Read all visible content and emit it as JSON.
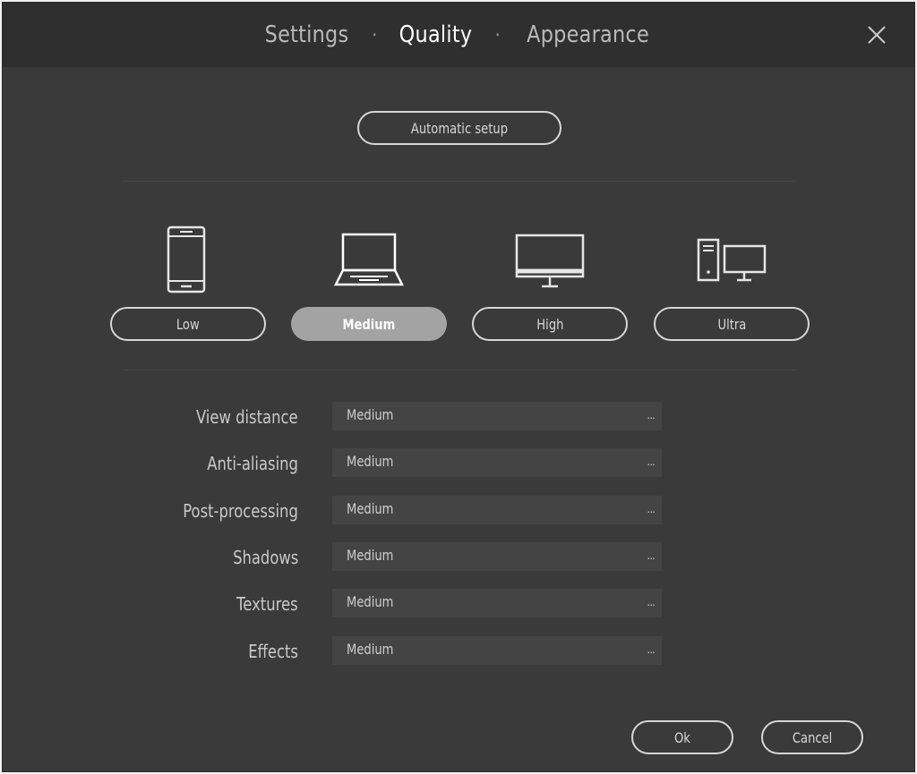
{
  "tabs": [
    {
      "label": "Settings",
      "active": false
    },
    {
      "label": "Quality",
      "active": true
    },
    {
      "label": "Appearance",
      "active": false
    }
  ],
  "tab_separator": "·",
  "auto_setup_label": "Automatic setup",
  "presets": [
    {
      "label": "Low",
      "icon": "phone-icon",
      "selected": false
    },
    {
      "label": "Medium",
      "icon": "laptop-icon",
      "selected": true
    },
    {
      "label": "High",
      "icon": "monitor-icon",
      "selected": false
    },
    {
      "label": "Ultra",
      "icon": "desktop-pc-icon",
      "selected": false
    }
  ],
  "settings": [
    {
      "label": "View distance",
      "value": "Medium"
    },
    {
      "label": "Anti-aliasing",
      "value": "Medium"
    },
    {
      "label": "Post-processing",
      "value": "Medium"
    },
    {
      "label": "Shadows",
      "value": "Medium"
    },
    {
      "label": "Textures",
      "value": "Medium"
    },
    {
      "label": "Effects",
      "value": "Medium"
    }
  ],
  "dropdown_indicator": "...",
  "ok_label": "Ok",
  "cancel_label": "Cancel",
  "colors": {
    "background": "#3a3a3a",
    "titlebar": "#2f2f2f",
    "selected_button": "#a3a3a3",
    "field": "#444444"
  }
}
